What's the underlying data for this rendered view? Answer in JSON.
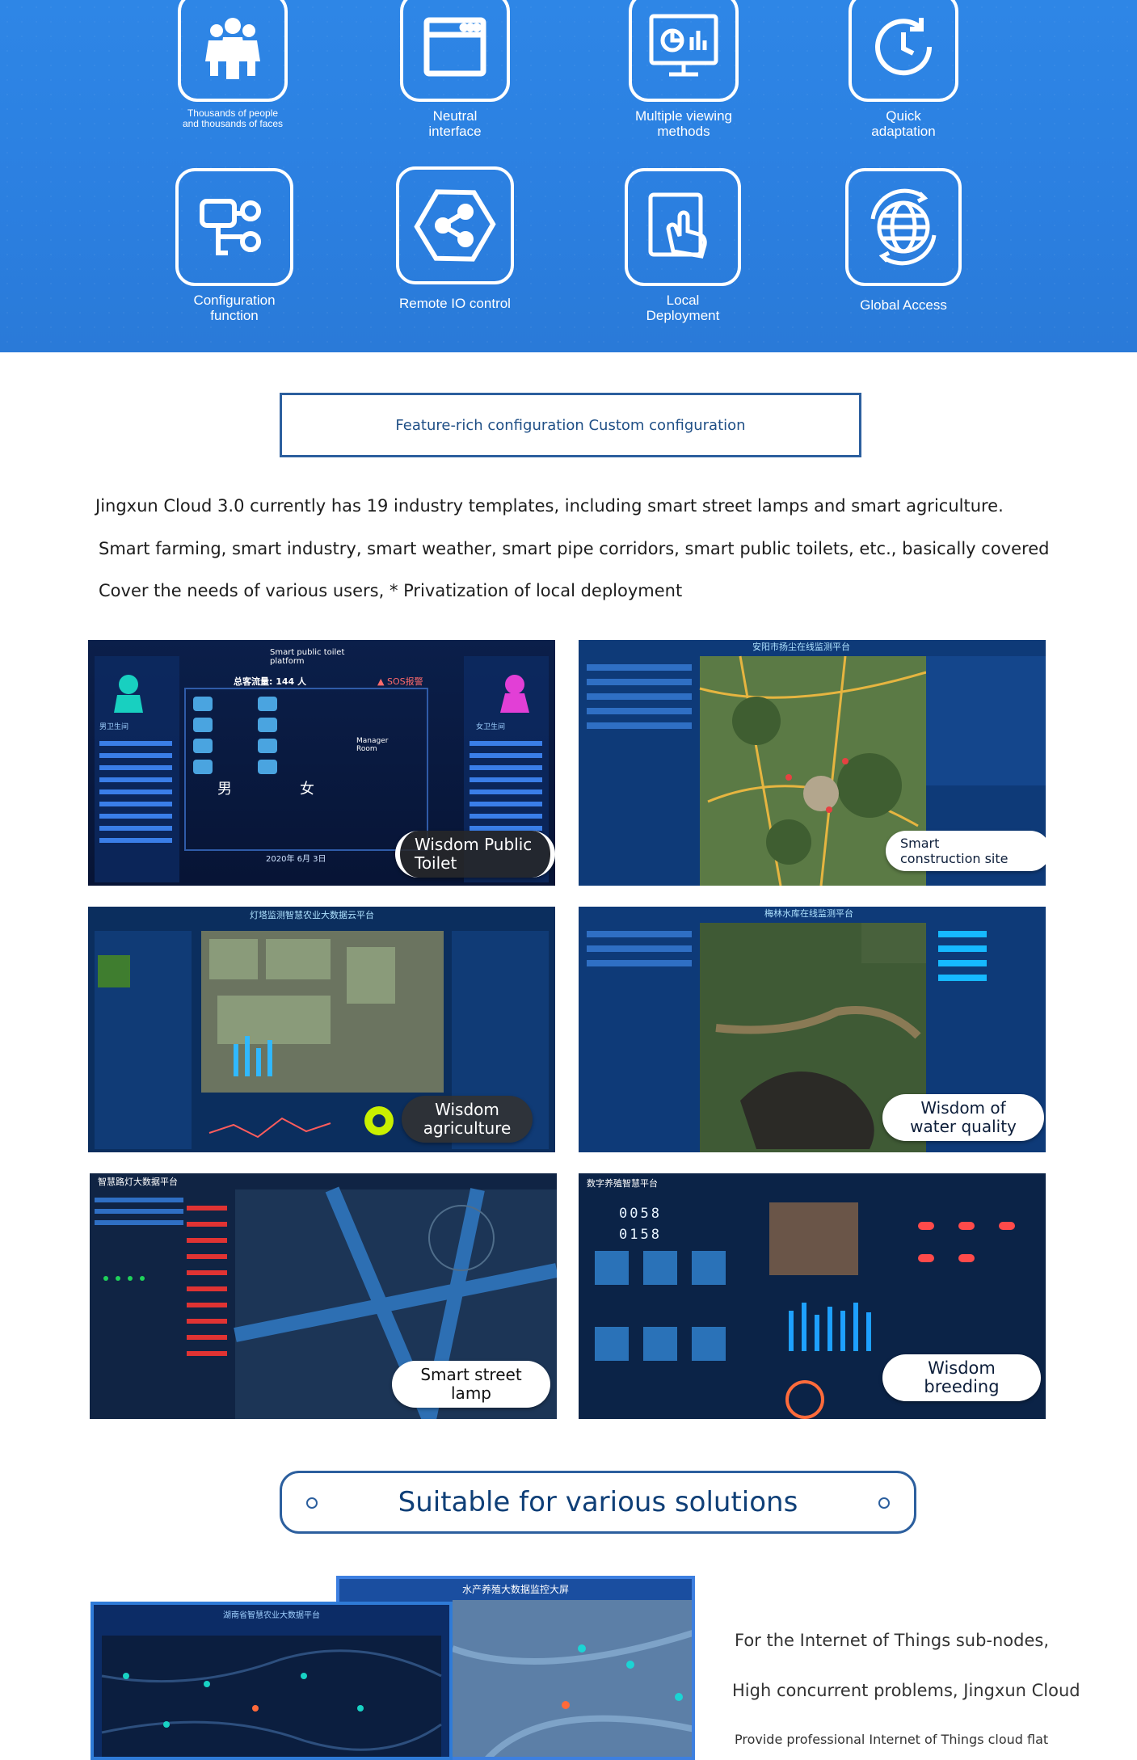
{
  "features": [
    {
      "icon": "people-icon",
      "label": "Thousands of people\nand thousands of faces"
    },
    {
      "icon": "window-icon",
      "label": "Neutral\ninterface"
    },
    {
      "icon": "monitor-chart-icon",
      "label": "Multiple viewing\nmethods"
    },
    {
      "icon": "clock-icon",
      "label": "Quick\nadaptation"
    },
    {
      "icon": "flow-icon",
      "label": "Configuration\nfunction"
    },
    {
      "icon": "share-hexagon-icon",
      "label": "Remote IO control"
    },
    {
      "icon": "touch-hand-icon",
      "label": "Local\nDeployment"
    },
    {
      "icon": "globe-icon",
      "label": "Global Access"
    }
  ],
  "config_title": "Feature-rich configuration Custom configuration",
  "description": [
    "Jingxun Cloud 3.0 currently has 19 industry templates, including smart street lamps and smart agriculture.",
    "Smart farming, smart industry, smart weather, smart pipe corridors, smart public toilets, etc., basically covered",
    "Cover the needs of various users, * Privatization of local deployment"
  ],
  "screens": [
    {
      "label": "Wisdom Public\nToilet",
      "overlay_title": "Smart public toilet\nplatform",
      "manager": "Manager\nRoom",
      "date": "2020年 6月 3日"
    },
    {
      "label": "Smart\nconstruction site",
      "overlay_title": "安阳市扬尘在线监测平台"
    },
    {
      "label": "Wisdom\nagriculture",
      "overlay_title": "灯塔监测智慧农业大数据云平台"
    },
    {
      "label": "Wisdom of\nwater quality",
      "overlay_title": "梅林水库在线监测平台"
    },
    {
      "label": "Smart street\nlamp",
      "overlay_title": "智慧路灯大数据平台"
    },
    {
      "label": "Wisdom\nbreeding",
      "overlay_title": "数字养殖智慧平台",
      "counters": [
        "0058",
        "0158"
      ]
    }
  ],
  "solutions_title": "Suitable for various solutions",
  "bottom_screens": {
    "front_title": "水产养殖大数据监控大屏",
    "back_title": "湖南省智慧农业大数据平台"
  },
  "iot_text": [
    "For the Internet of Things sub-nodes,",
    "High concurrent problems, Jingxun Cloud",
    "Provide professional Internet of Things cloud flat"
  ],
  "colors": {
    "band": "#2b7fe0",
    "border": "#2c5f9e",
    "dashboard": "#0b2a55"
  }
}
